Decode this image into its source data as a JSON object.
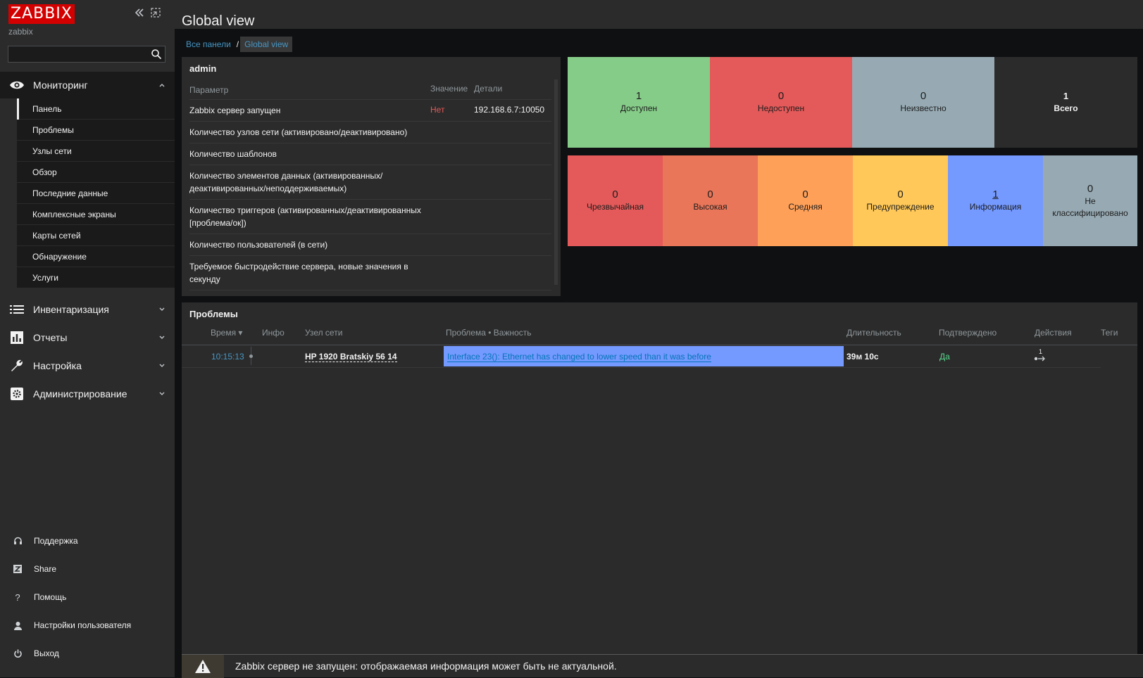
{
  "sidebar": {
    "logo": "ZABBIX",
    "server_name": "zabbix",
    "search_placeholder": "",
    "sections": [
      {
        "label": "Мониторинг",
        "icon": "eye-icon",
        "expanded": true
      },
      {
        "label": "Инвентаризация",
        "icon": "list-icon",
        "expanded": false
      },
      {
        "label": "Отчеты",
        "icon": "bar-chart-icon",
        "expanded": false
      },
      {
        "label": "Настройка",
        "icon": "wrench-icon",
        "expanded": false
      },
      {
        "label": "Администрирование",
        "icon": "cog-icon",
        "expanded": false
      }
    ],
    "monitoring_items": [
      {
        "label": "Панель",
        "active": true
      },
      {
        "label": "Проблемы"
      },
      {
        "label": "Узлы сети"
      },
      {
        "label": "Обзор"
      },
      {
        "label": "Последние данные"
      },
      {
        "label": "Комплексные экраны"
      },
      {
        "label": "Карты сетей"
      },
      {
        "label": "Обнаружение"
      },
      {
        "label": "Услуги"
      }
    ],
    "bottom_items": [
      {
        "label": "Поддержка",
        "icon": "headset-icon"
      },
      {
        "label": "Share",
        "icon": "share-z-icon"
      },
      {
        "label": "Помощь",
        "icon": "question-icon"
      },
      {
        "label": "Настройки пользователя",
        "icon": "user-icon"
      },
      {
        "label": "Выход",
        "icon": "power-icon"
      }
    ]
  },
  "header": {
    "title": "Global view",
    "breadcrumb": [
      "Все панели",
      "Global view"
    ]
  },
  "system_info": {
    "title": "admin",
    "columns": [
      "Параметр",
      "Значение",
      "Детали"
    ],
    "rows": [
      {
        "param": "Zabbix сервер запущен",
        "value": "Нет",
        "details": "192.168.6.7:10050"
      },
      {
        "param": "Количество узлов сети (активировано/деактивировано)",
        "value": "",
        "details": ""
      },
      {
        "param": "Количество шаблонов",
        "value": "",
        "details": ""
      },
      {
        "param_line1": "Количество элементов данных (активированных/",
        "param_line2": "деактивированных/неподдерживаемых)",
        "value": "",
        "details": ""
      },
      {
        "param_line1": "Количество триггеров (активированных/деактивированных",
        "param_line2": "[проблема/ок])",
        "value": "",
        "details": ""
      },
      {
        "param": "Количество пользователей (в сети)",
        "value": "",
        "details": ""
      },
      {
        "param_line1": "Требуемое быстродействие сервера, новые значения в",
        "param_line2": "секунду",
        "value": "",
        "details": ""
      }
    ]
  },
  "host_availability": [
    {
      "count": "1",
      "label": "Доступен",
      "color": "#86cc89"
    },
    {
      "count": "0",
      "label": "Недоступен",
      "color": "#e45959"
    },
    {
      "count": "0",
      "label": "Неизвестно",
      "color": "#97aab3"
    },
    {
      "count": "1",
      "label": "Всего",
      "color": "#2b2b2b"
    }
  ],
  "severity": [
    {
      "count": "0",
      "label": "Чрезвычайная",
      "color": "#e45959"
    },
    {
      "count": "0",
      "label": "Высокая",
      "color": "#e97659"
    },
    {
      "count": "0",
      "label": "Средняя",
      "color": "#ffa059"
    },
    {
      "count": "0",
      "label": "Предупреждение",
      "color": "#ffc859"
    },
    {
      "count": "1",
      "label": "Информация",
      "color": "#7499ff"
    },
    {
      "count": "0",
      "label_line1": "Не",
      "label_line2": "классифицировано",
      "color": "#97aab3"
    }
  ],
  "problems": {
    "title": "Проблемы",
    "columns": [
      "Время ▾",
      "Инфо",
      "Узел сети",
      "Проблема • Важность",
      "Длительность",
      "Подтверждено",
      "Действия",
      "Теги"
    ],
    "rows": [
      {
        "time": "10:15:13",
        "info": "",
        "host": "HP 1920 Bratskiy 56 14",
        "problem": "Interface 23(): Ethernet has changed to lower speed than it was before",
        "duration": "39м 10с",
        "ack": "Да",
        "actions_count": "1",
        "tags": ""
      }
    ]
  },
  "warning": {
    "text": "Zabbix сервер не запущен: отображаемая информация может быть не актуальной."
  },
  "colors": {
    "accent_link": "#4796c4",
    "value_red": "#e45959",
    "ack_green": "#59db8f",
    "info_row": "#7499ff"
  }
}
